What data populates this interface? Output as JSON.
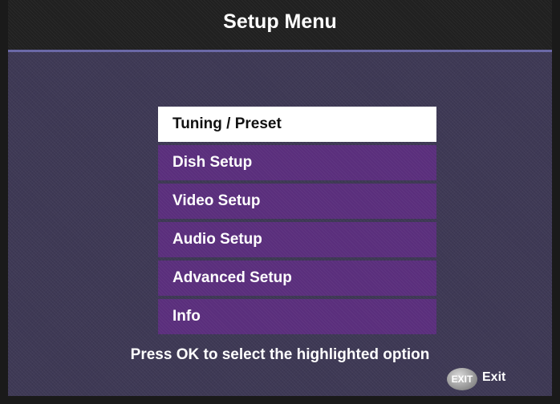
{
  "header": {
    "title": "Setup Menu"
  },
  "menu": {
    "items": [
      {
        "label": "Tuning / Preset",
        "selected": true
      },
      {
        "label": "Dish Setup",
        "selected": false
      },
      {
        "label": "Video Setup",
        "selected": false
      },
      {
        "label": "Audio Setup",
        "selected": false
      },
      {
        "label": "Advanced Setup",
        "selected": false
      },
      {
        "label": "Info",
        "selected": false
      }
    ]
  },
  "footer": {
    "hint": "Press OK to select the highlighted option",
    "exit_badge": "EXIT",
    "exit_label": "Exit"
  },
  "colors": {
    "background": "#3e3955",
    "title_bar": "#202020",
    "menu_item": "#5a2e7c",
    "menu_selected": "#ffffff",
    "accent_line": "#6a68a6"
  }
}
